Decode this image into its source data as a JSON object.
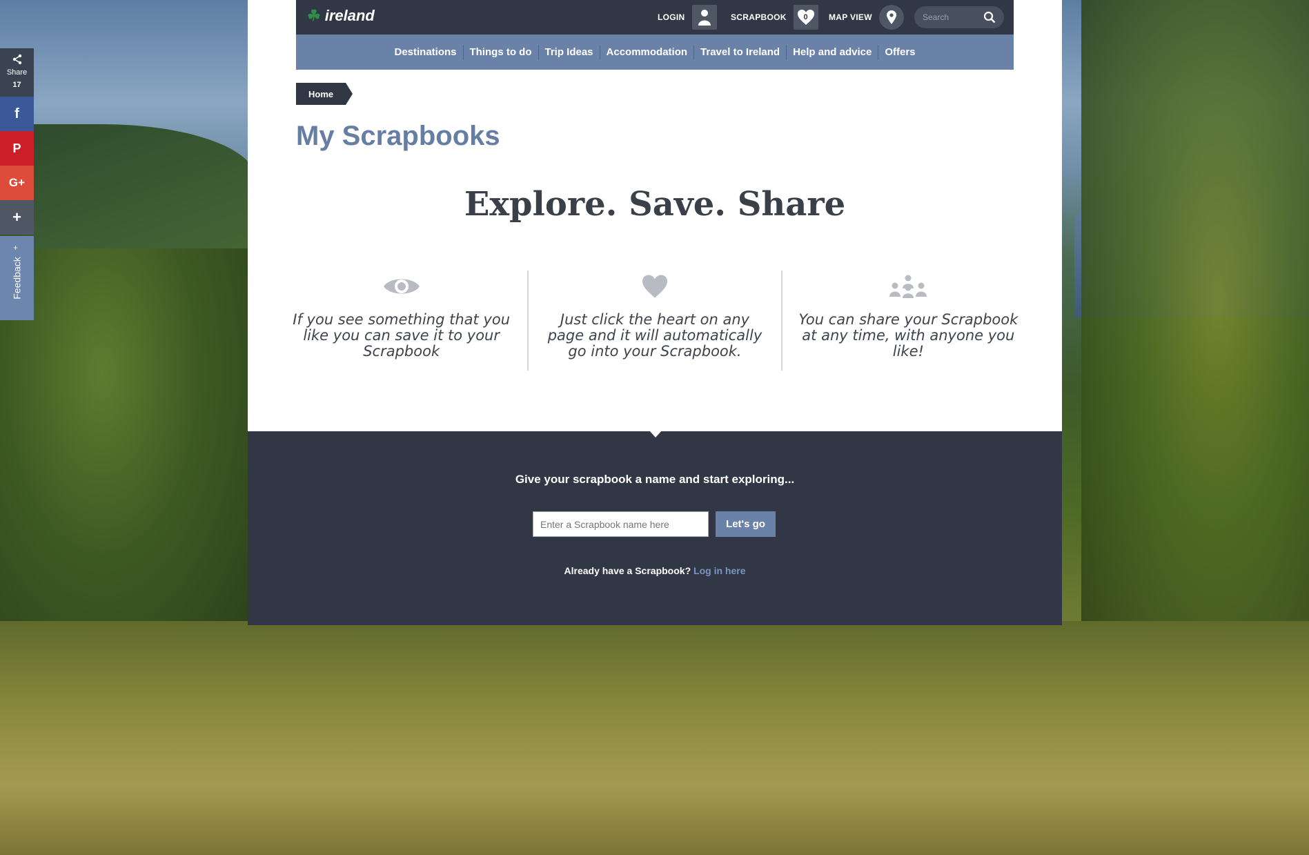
{
  "share_bar": {
    "share_label": "Share",
    "share_count": "17",
    "feedback_label": "Feedback"
  },
  "header": {
    "logo_text": "ireland",
    "login_label": "LOGIN",
    "scrapbook_label": "SCRAPBOOK",
    "scrapbook_count": "0",
    "mapview_label": "MAP VIEW",
    "search_placeholder": "Search"
  },
  "nav": {
    "items": [
      "Destinations",
      "Things to do",
      "Trip Ideas",
      "Accommodation",
      "Travel to Ireland",
      "Help and advice",
      "Offers"
    ]
  },
  "breadcrumb": {
    "home": "Home"
  },
  "main": {
    "title": "My Scrapbooks",
    "headline": "Explore. Save. Share",
    "features": [
      {
        "icon": "eye-icon",
        "text": "If you see something that you like you can save it to your Scrapbook"
      },
      {
        "icon": "heart-icon",
        "text": "Just click the heart on any page and it will automatically go into your Scrapbook."
      },
      {
        "icon": "people-icon",
        "text": "You can share your Scrapbook at any time, with anyone you like!"
      }
    ]
  },
  "cta": {
    "heading": "Give your scrapbook a name and start exploring...",
    "input_placeholder": "Enter a Scrapbook name here",
    "button_label": "Let's go",
    "already_text": "Already have a Scrapbook?",
    "login_link": "Log in here"
  },
  "colors": {
    "dark": "#313744",
    "accent": "#6b82a8",
    "link": "#7a96c2"
  }
}
